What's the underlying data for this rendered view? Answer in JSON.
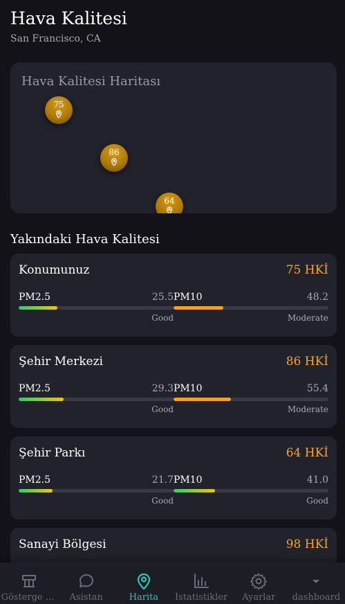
{
  "header": {
    "title": "Hava Kalitesi",
    "location": "San Francisco, CA"
  },
  "map": {
    "title": "Hava Kalitesi Haritası",
    "markers": [
      {
        "value": "75"
      },
      {
        "value": "86"
      },
      {
        "value": "64"
      }
    ]
  },
  "nearby": {
    "title": "Yakındaki Hava Kalitesi",
    "cards": [
      {
        "name": "Konumunuz",
        "aqi": "75 HKİ",
        "pm25": {
          "label": "PM2.5",
          "value": "25.5",
          "status": "Good",
          "fill": 0.25
        },
        "pm10": {
          "label": "PM10",
          "value": "48.2",
          "status": "Moderate",
          "fill": 0.32
        }
      },
      {
        "name": "Şehir Merkezi",
        "aqi": "86 HKİ",
        "pm25": {
          "label": "PM2.5",
          "value": "29.3",
          "status": "Good",
          "fill": 0.29
        },
        "pm10": {
          "label": "PM10",
          "value": "55.4",
          "status": "Moderate",
          "fill": 0.37
        }
      },
      {
        "name": "Şehir Parkı",
        "aqi": "64 HKİ",
        "pm25": {
          "label": "PM2.5",
          "value": "21.7",
          "status": "Good",
          "fill": 0.22
        },
        "pm10": {
          "label": "PM10",
          "value": "41.0",
          "status": "Good",
          "fill": 0.27
        }
      },
      {
        "name": "Sanayi Bölgesi",
        "aqi": "98 HKİ"
      }
    ]
  },
  "tabs": [
    {
      "label": "Gösterge P...",
      "icon": "gauge-icon"
    },
    {
      "label": "Asistan",
      "icon": "chat-icon"
    },
    {
      "label": "Harita",
      "icon": "map-pin-icon",
      "active": true
    },
    {
      "label": "İstatistikler",
      "icon": "bar-chart-icon"
    },
    {
      "label": "Ayarlar",
      "icon": "gear-icon"
    },
    {
      "label": "dashboard",
      "icon": "chevron-down-icon"
    }
  ],
  "colors": {
    "background": "#121218",
    "card": "#22222c",
    "accent": "#2ec4b6",
    "aqi": "#f5a623",
    "good_gradient": [
      "#2ecc71",
      "#f1c40f"
    ],
    "moderate": "#f7a11a"
  }
}
